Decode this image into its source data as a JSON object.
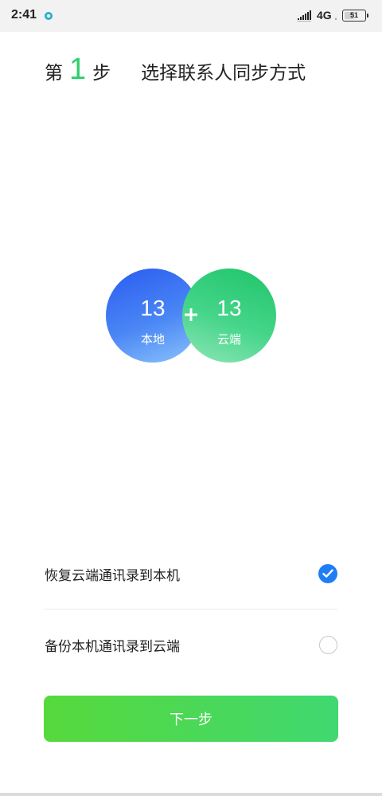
{
  "status_bar": {
    "time": "2:41",
    "network": "4G",
    "network_sub": "ᵢₗ",
    "battery": "51",
    "battery_level": 0.51,
    "icons": [
      "app-notification-icon",
      "signal-icon",
      "battery-icon"
    ]
  },
  "header": {
    "step_prefix": "第",
    "step_number": "1",
    "step_suffix": "步",
    "title": "选择联系人同步方式"
  },
  "venn": {
    "local": {
      "count": "13",
      "label": "本地"
    },
    "cloud": {
      "count": "13",
      "label": "云端"
    },
    "plus": "+"
  },
  "options": [
    {
      "label": "恢复云端通讯录到本机",
      "selected": true
    },
    {
      "label": "备份本机通讯录到云端",
      "selected": false
    }
  ],
  "next_button": {
    "label": "下一步"
  },
  "colors": {
    "accent_green": "#2fcf6d",
    "local_blue": "#2a5cf0",
    "cloud_green": "#1fc46a",
    "check_blue": "#1f7ef5"
  }
}
